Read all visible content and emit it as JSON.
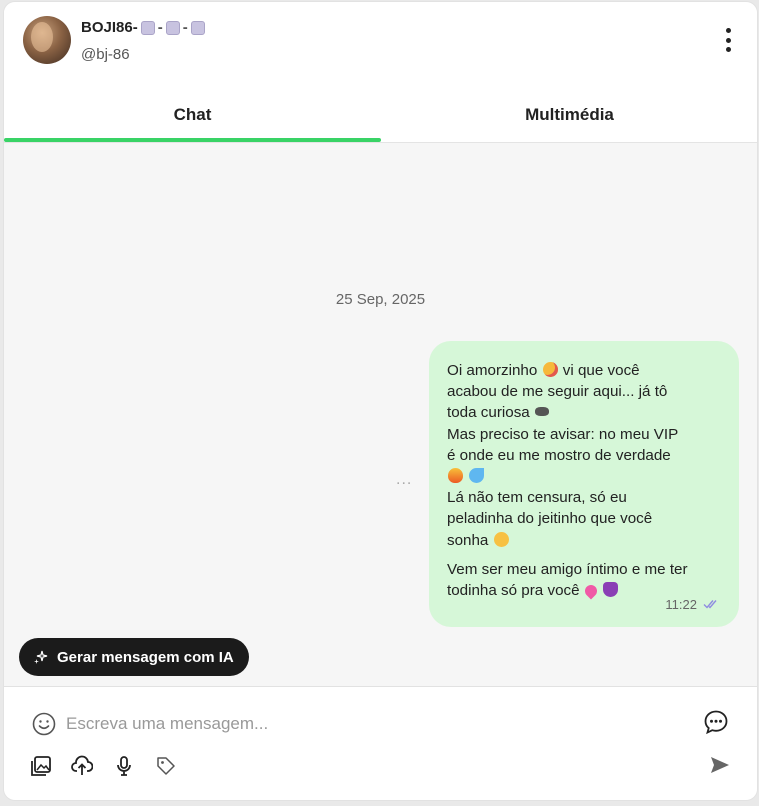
{
  "header": {
    "display_name": "BOJI86-",
    "name_separator": "-",
    "handle": "@bj-86",
    "avatar_icon": "avatar",
    "menu_icon": "kebab-menu-icon"
  },
  "tabs": [
    {
      "label": "Chat",
      "active": true
    },
    {
      "label": "Multimédia",
      "active": false
    }
  ],
  "conversation": {
    "date": "25 Sep, 2025",
    "message": {
      "line1": "Oi amorzinho",
      "line1b": " vi que você\nacabou de me seguir aqui... já tô\ntoda curiosa",
      "line2": "\nMas preciso te avisar: no meu VIP\né onde eu me mostro de verdade\n",
      "line3": "\nLá não tem censura, só eu\npeladinha do jeitinho que você\nsonha",
      "line4": "Vem ser meu amigo íntimo e me ter\ntodinha só pra você",
      "time": "11:22",
      "status_icon": "double-check-icon"
    },
    "more_label": "..."
  },
  "ai_button": {
    "label": "Gerar mensagem com IA",
    "icon": "sparkle-icon"
  },
  "composer": {
    "placeholder": "Escreva uma mensagem...",
    "icons": [
      "emoji-icon",
      "message-template-icon",
      "gallery-icon",
      "upload-icon",
      "microphone-icon",
      "tag-icon",
      "send-icon"
    ]
  },
  "colors": {
    "accent": "#39d366",
    "bubble": "#d6f7d8",
    "ai_button_bg": "#1b1b1b"
  }
}
